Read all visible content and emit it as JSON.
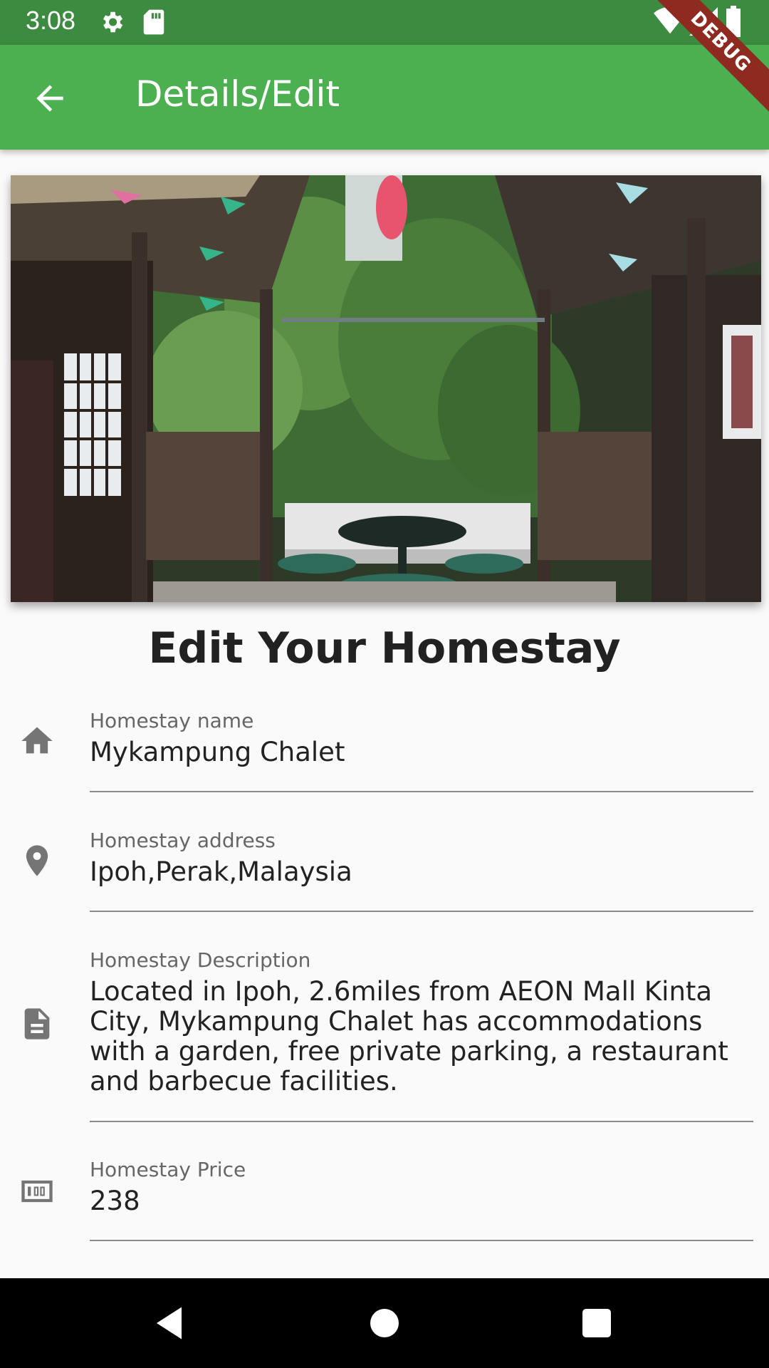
{
  "status_bar": {
    "time": "3:08",
    "icons": [
      "settings-icon",
      "sd-card-icon",
      "wifi-icon",
      "signal-icon",
      "battery-icon"
    ]
  },
  "debug_banner": {
    "label": "DEBUG"
  },
  "app_bar": {
    "title": "Details/Edit",
    "back_icon": "arrow-back-icon",
    "color": "#4caf50"
  },
  "main": {
    "heading": "Edit Your Homestay",
    "fields": [
      {
        "icon": "home-icon",
        "label": "Homestay name",
        "value": "Mykampung Chalet"
      },
      {
        "icon": "location-pin-icon",
        "label": "Homestay address",
        "value": "Ipoh,Perak,Malaysia"
      },
      {
        "icon": "description-icon",
        "label": "Homestay Description",
        "value": "Located in Ipoh, 2.6miles from AEON Mall Kinta City, Mykampung Chalet has accommodations with a garden, free private parking, a restaurant and barbecue facilities."
      },
      {
        "icon": "money-icon",
        "label": "Homestay Price",
        "value": "238"
      }
    ]
  },
  "nav_bar": {
    "icons": [
      "back-triangle-icon",
      "home-circle-icon",
      "recents-square-icon"
    ]
  }
}
